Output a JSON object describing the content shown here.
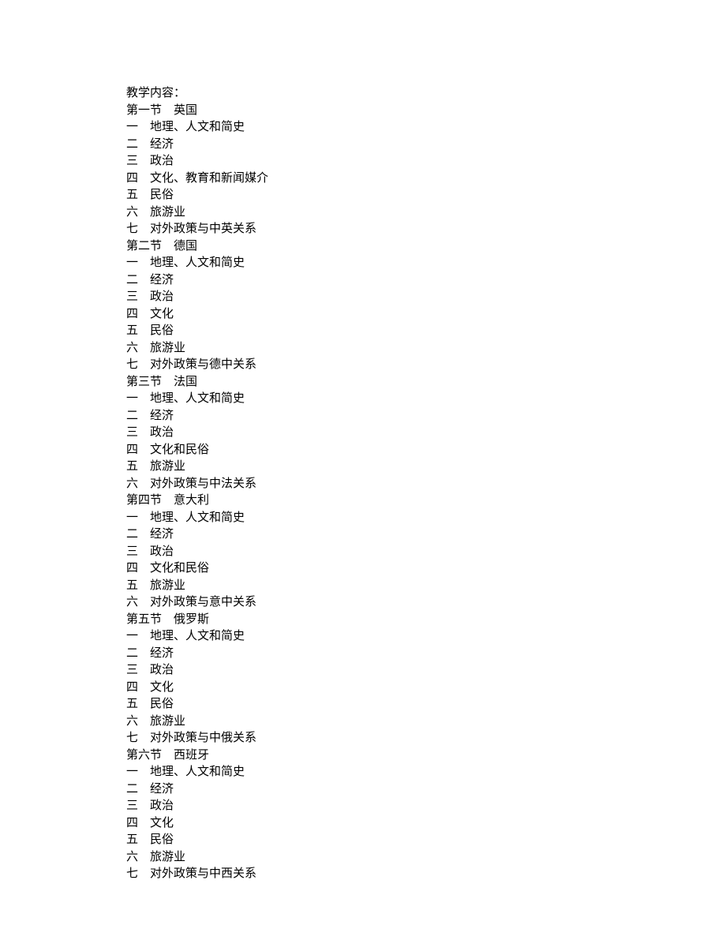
{
  "header": "教学内容：",
  "sections": [
    {
      "title": "第一节    英国",
      "items": [
        "一    地理、人文和简史",
        "二    经济",
        "三    政治",
        "四    文化、教育和新闻媒介",
        "五    民俗",
        "六    旅游业",
        "七    对外政策与中英关系"
      ]
    },
    {
      "title": "第二节    德国",
      "items": [
        "一    地理、人文和简史",
        "二    经济",
        "三    政治",
        "四    文化",
        "五    民俗",
        "六    旅游业",
        "七    对外政策与德中关系"
      ]
    },
    {
      "title": "第三节    法国",
      "items": [
        "一    地理、人文和简史",
        "二    经济",
        "三    政治",
        "四    文化和民俗",
        "五    旅游业",
        "六    对外政策与中法关系"
      ]
    },
    {
      "title": "第四节    意大利",
      "items": [
        "一    地理、人文和简史",
        "二    经济",
        "三    政治",
        "四    文化和民俗",
        "五    旅游业",
        "六    对外政策与意中关系"
      ]
    },
    {
      "title": "第五节    俄罗斯",
      "items": [
        "一    地理、人文和简史",
        "二    经济",
        "三    政治",
        "四    文化",
        "五    民俗",
        "六    旅游业",
        "七    对外政策与中俄关系"
      ]
    },
    {
      "title": "第六节    西班牙",
      "items": [
        "一    地理、人文和简史",
        "二    经济",
        "三    政治",
        "四    文化",
        "五    民俗",
        "六    旅游业",
        "七    对外政策与中西关系"
      ]
    }
  ]
}
